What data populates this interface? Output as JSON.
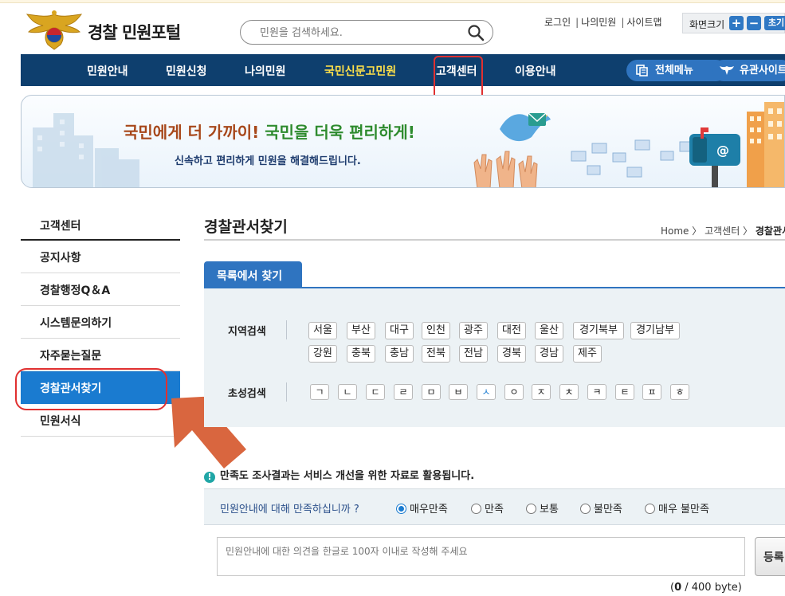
{
  "header": {
    "site_title": "경찰 민원포털",
    "search_placeholder": "민원을 검색하세요.",
    "util_links": [
      "로그인",
      "나의민원",
      "사이트맵"
    ],
    "font_size_label": "화면크기",
    "font_plus": "+",
    "font_minus": "−",
    "font_reset": "초기"
  },
  "gnb": {
    "items": [
      "민원안내",
      "민원신청",
      "나의민원",
      "국민신문고민원",
      "고객센터",
      "이용안내"
    ],
    "highlighted_index": 3,
    "all_menu": "전체메뉴",
    "related_sites": "유관사이트"
  },
  "banner": {
    "slogan_part1": "국민에게 더 가까이!",
    "slogan_part2": "국민을 더욱 편리하게!",
    "sub": "신속하고 편리하게 민원을 해결해드립니다."
  },
  "lnb": {
    "title": "고객센터",
    "items": [
      "공지사항",
      "경찰행정Q＆A",
      "시스템문의하기",
      "자주묻는질문",
      "경찰관서찾기",
      "민원서식"
    ],
    "active_index": 4
  },
  "content": {
    "title": "경찰관서찾기",
    "breadcrumb_home": "Home",
    "breadcrumb_mid": "고객센터",
    "breadcrumb_current": "경찰관서찾기",
    "tab": "목록에서 찾기",
    "region_label": "지역검색",
    "regions_row1": [
      "서울",
      "부산",
      "대구",
      "인천",
      "광주",
      "대전",
      "울산",
      "경기북부",
      "경기남부"
    ],
    "regions_row2": [
      "강원",
      "충북",
      "충남",
      "전북",
      "전남",
      "경북",
      "경남",
      "제주"
    ],
    "initial_label": "초성검색",
    "initials": [
      "ㄱ",
      "ㄴ",
      "ㄷ",
      "ㄹ",
      "ㅁ",
      "ㅂ",
      "ㅅ",
      "ㅇ",
      "ㅈ",
      "ㅊ",
      "ㅋ",
      "ㅌ",
      "ㅍ",
      "ㅎ"
    ],
    "initial_selected_index": 6
  },
  "survey": {
    "notice": "만족도 조사결과는 서비스 개선을 위한 자료로 활용됩니다.",
    "question": "민원안내에 대해 만족하십니까 ?",
    "options": [
      "매우만족",
      "만족",
      "보통",
      "불만족",
      "매우 불만족"
    ],
    "selected_index": 0,
    "opinion_placeholder": "민원안내에 대한 의견을 한글로 100자 이내로 작성해 주세요",
    "submit": "등록",
    "counter_current": "0",
    "counter_rest": " / 400 byte)"
  },
  "colors": {
    "gnb_bg": "#0e3f6e",
    "accent_blue": "#1a7bd0",
    "highlight_yellow": "#ffe14a",
    "annotation_red": "#e03030",
    "arrow_orange": "#d9663f"
  }
}
